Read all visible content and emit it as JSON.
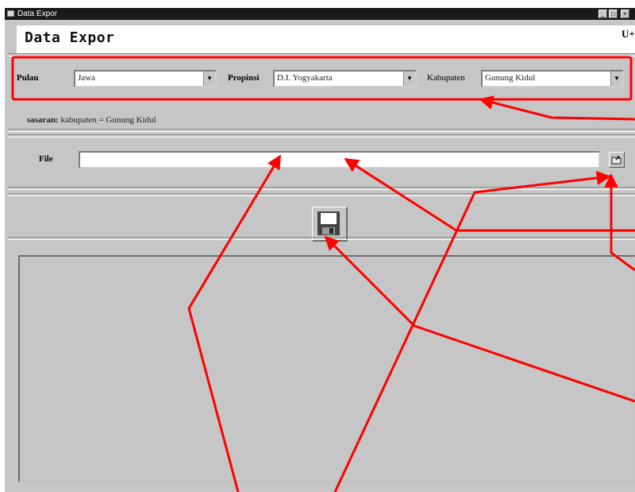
{
  "window": {
    "title": "Data Expor"
  },
  "header": {
    "title": "Data Expor",
    "exit_label": "U+"
  },
  "filters": {
    "pulau": {
      "label": "Pulau",
      "value": "Jawa"
    },
    "propinsi": {
      "label": "Propinsi",
      "value": "D.I. Yogyakarta"
    },
    "kabupaten": {
      "label": "Kabupaten",
      "value": "Gunung Kidul"
    }
  },
  "filter_summary": {
    "label": "sasaran:",
    "value": "kabupaten = Gunung Kidul"
  },
  "file": {
    "label": "File",
    "value": ""
  },
  "colors": {
    "annotation": "#ff0000",
    "window_bg": "#c6c6c6"
  },
  "icons": {
    "browse": "open-folder-icon",
    "save": "floppy-disk-icon"
  }
}
